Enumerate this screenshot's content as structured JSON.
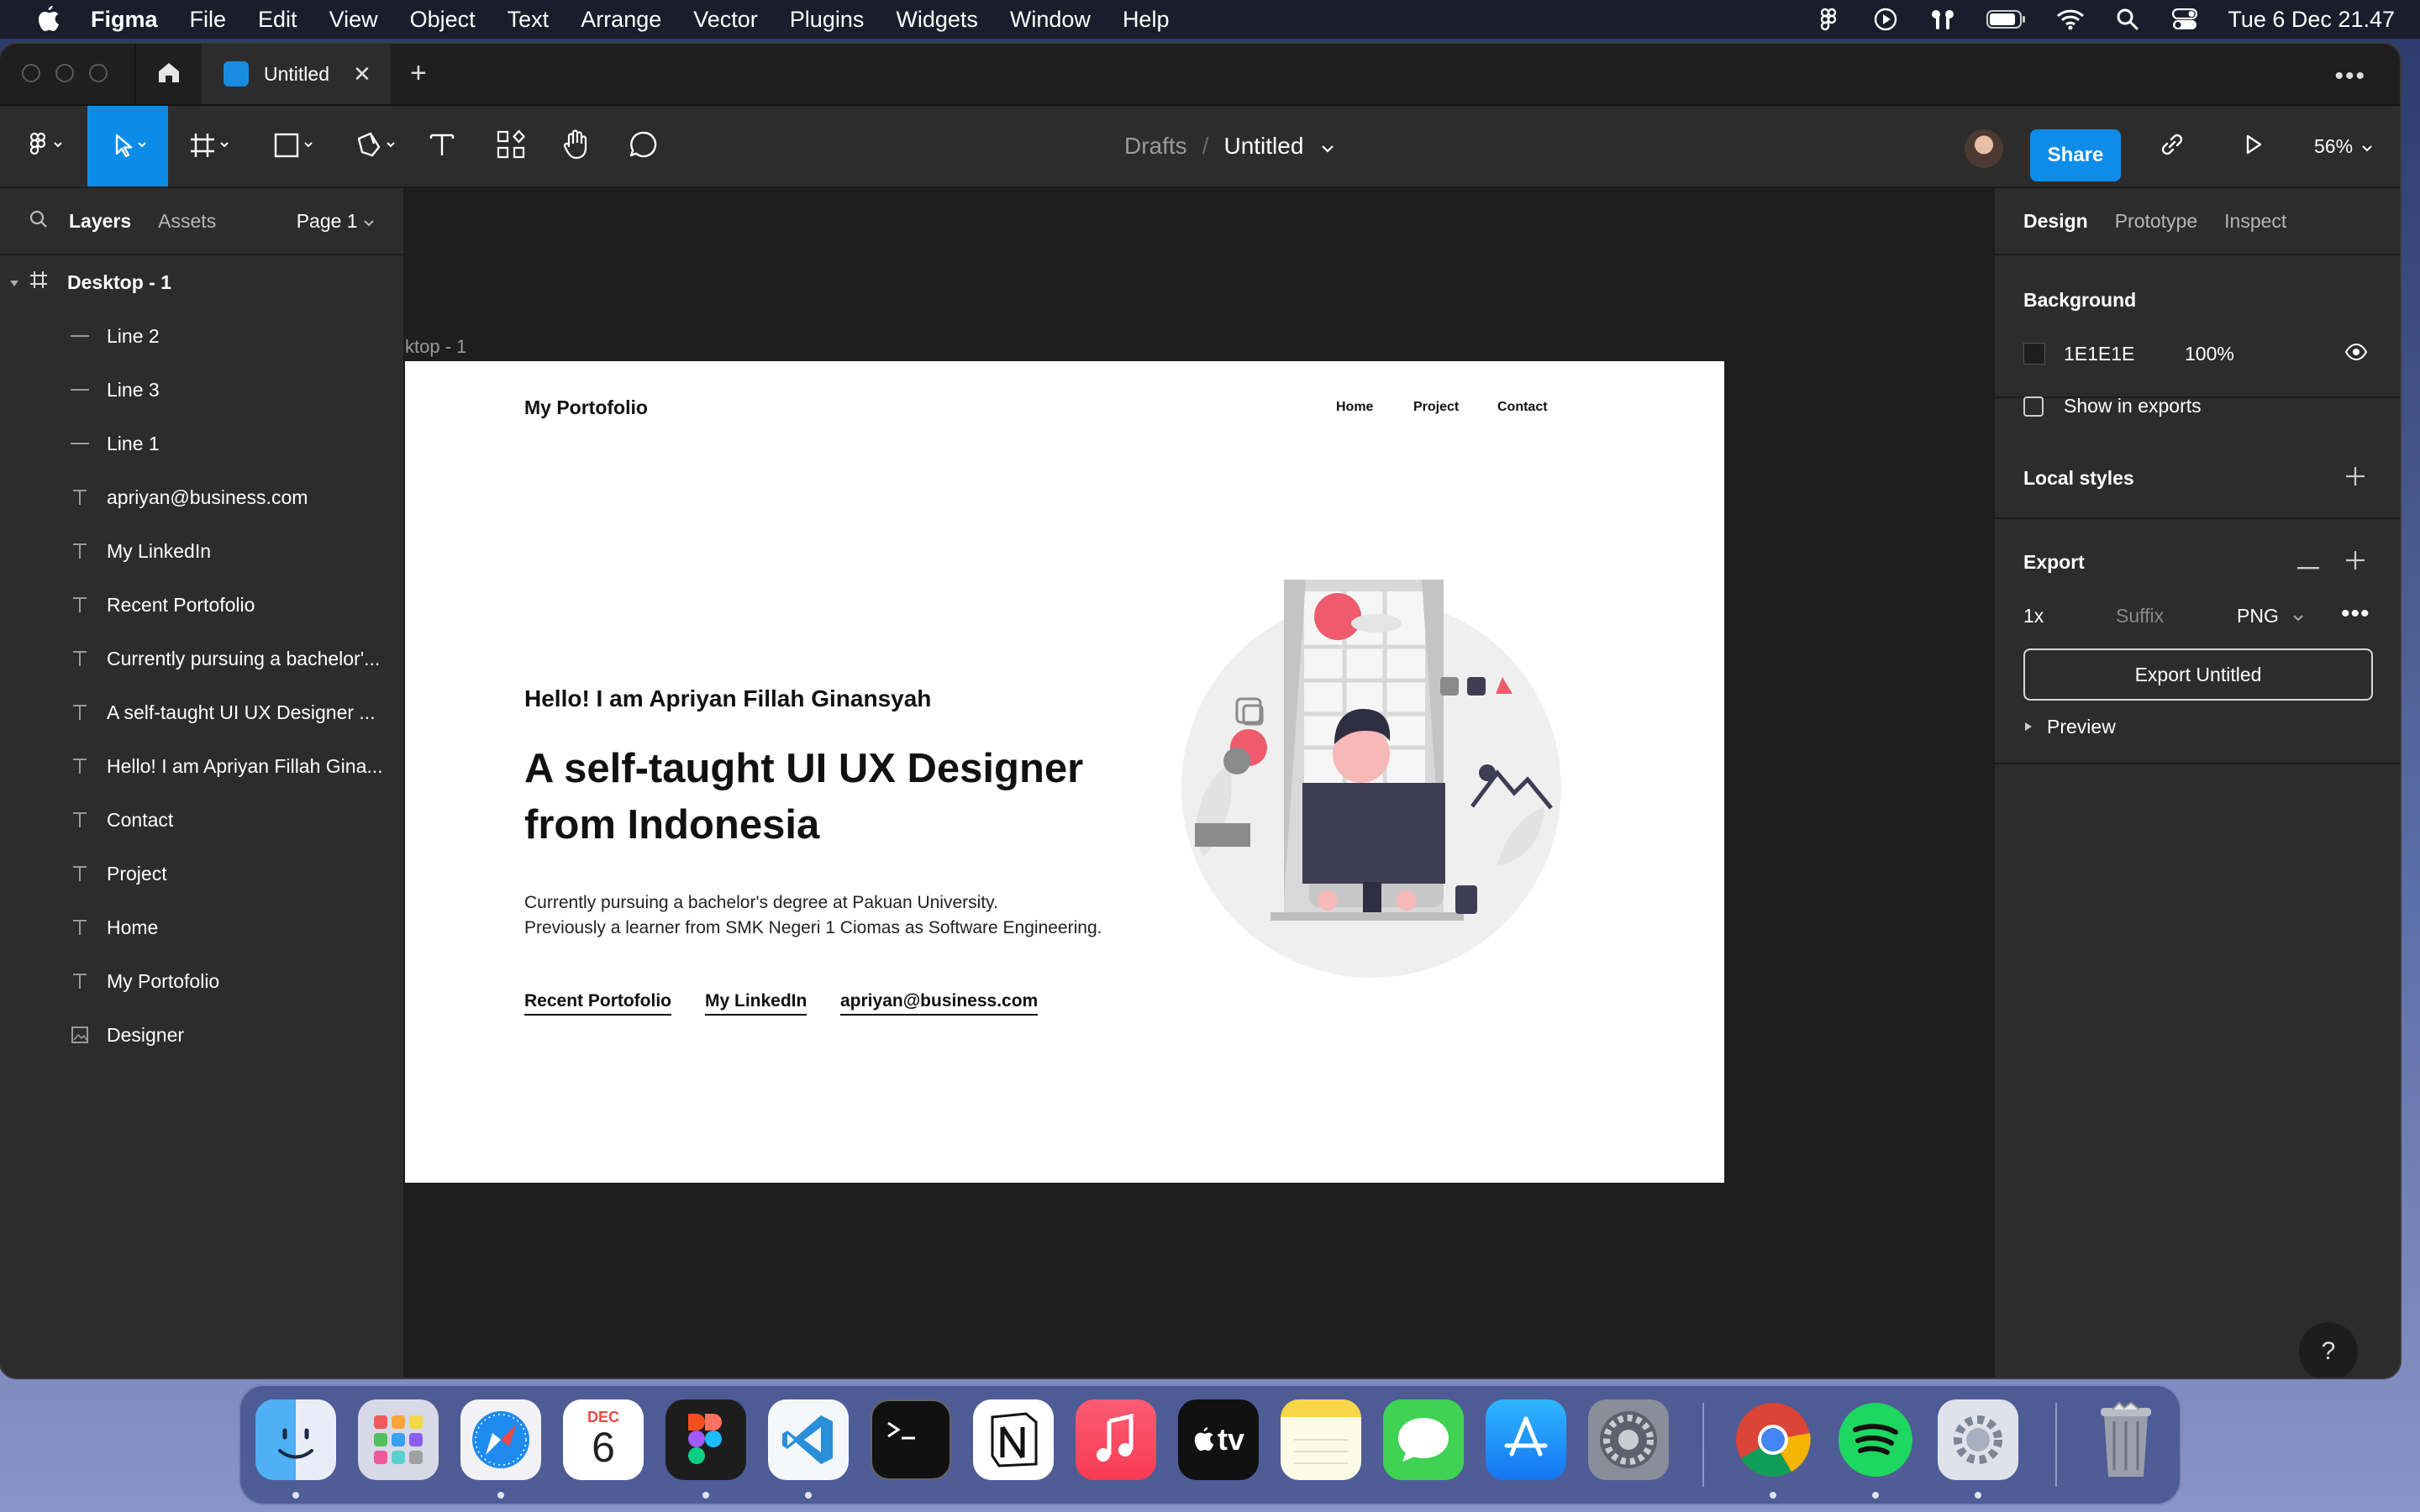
{
  "menubar": {
    "app_name": "Figma",
    "items": [
      "File",
      "Edit",
      "View",
      "Object",
      "Text",
      "Arrange",
      "Vector",
      "Plugins",
      "Widgets",
      "Window",
      "Help"
    ],
    "clock": "Tue 6 Dec  21.47"
  },
  "window": {
    "tab_title": "Untitled",
    "breadcrumb": {
      "folder": "Drafts",
      "separator": "/",
      "file": "Untitled"
    },
    "share_label": "Share",
    "zoom": "56%"
  },
  "left_panel": {
    "tabs": [
      "Layers",
      "Assets"
    ],
    "page": "Page 1",
    "frame_name": "Desktop - 1",
    "layers": [
      {
        "name": "Line 2",
        "type": "line"
      },
      {
        "name": "Line 3",
        "type": "line"
      },
      {
        "name": "Line 1",
        "type": "line"
      },
      {
        "name": "apriyan@business.com",
        "type": "text"
      },
      {
        "name": "My LinkedIn",
        "type": "text"
      },
      {
        "name": "Recent Portofolio",
        "type": "text"
      },
      {
        "name": "Currently pursuing a bachelor'...",
        "type": "text"
      },
      {
        "name": "A self-taught UI UX Designer ...",
        "type": "text"
      },
      {
        "name": "Hello! I am Apriyan Fillah Gina...",
        "type": "text"
      },
      {
        "name": "Contact",
        "type": "text"
      },
      {
        "name": "Project",
        "type": "text"
      },
      {
        "name": "Home",
        "type": "text"
      },
      {
        "name": "My Portofolio",
        "type": "text"
      },
      {
        "name": "Designer",
        "type": "image"
      }
    ]
  },
  "canvas": {
    "frame_label": "ktop - 1",
    "artboard": {
      "logo": "My Portofolio",
      "nav": [
        "Home",
        "Project",
        "Contact"
      ],
      "hello": "Hello! I am Apriyan Fillah Ginansyah",
      "headline_line1": "A self-taught UI UX Designer",
      "headline_line2": "from Indonesia",
      "body_line1": "Currently pursuing a bachelor's degree at Pakuan University.",
      "body_line2": "Previously a learner from SMK Negeri 1 Ciomas as Software Engineering.",
      "links": [
        "Recent Portofolio",
        "My LinkedIn",
        "apriyan@business.com"
      ]
    }
  },
  "right_panel": {
    "tabs": [
      "Design",
      "Prototype",
      "Inspect"
    ],
    "background": {
      "title": "Background",
      "hex": "1E1E1E",
      "opacity": "100%",
      "show_in_exports": "Show in exports"
    },
    "local_styles": "Local styles",
    "export": {
      "title": "Export",
      "scale": "1x",
      "suffix_placeholder": "Suffix",
      "format": "PNG",
      "button": "Export Untitled",
      "preview": "Preview"
    },
    "help": "?"
  },
  "dock": {
    "calendar_month": "DEC",
    "calendar_day": "6",
    "appletv_label": "tv"
  }
}
